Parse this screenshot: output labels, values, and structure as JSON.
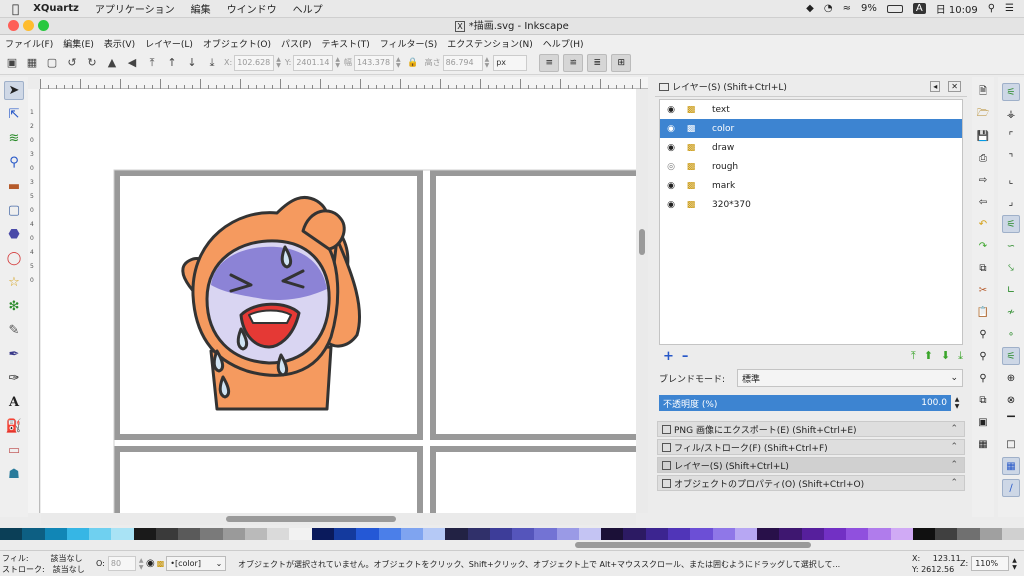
{
  "mac_menubar": {
    "app_name": "XQuartz",
    "items": [
      "アプリケーション",
      "編集",
      "ウインドウ",
      "ヘルプ"
    ],
    "battery": "9%",
    "input_mode": "A",
    "clock": "日 10:09"
  },
  "window": {
    "title": "*描画.svg - Inkscape"
  },
  "menu": [
    "ファイル(F)",
    "編集(E)",
    "表示(V)",
    "レイヤー(L)",
    "オブジェクト(O)",
    "パス(P)",
    "テキスト(T)",
    "フィルター(S)",
    "エクステンション(N)",
    "ヘルプ(H)"
  ],
  "toolbar": {
    "x_label": "X:",
    "x_value": "102.628",
    "y_label": "Y:",
    "y_value": "2401.14",
    "w_label": "幅",
    "w_value": "143.378",
    "h_label": "高さ",
    "h_value": "86.794",
    "unit": "px"
  },
  "layers_panel": {
    "title": "レイヤー(S) (Shift+Ctrl+L)",
    "layers": [
      {
        "name": "text",
        "selected": false
      },
      {
        "name": "color",
        "selected": true
      },
      {
        "name": "draw",
        "selected": false
      },
      {
        "name": "rough",
        "selected": false
      },
      {
        "name": "mark",
        "selected": false
      },
      {
        "name": "320*370",
        "selected": false
      }
    ],
    "blend_label": "ブレンドモード:",
    "blend_value": "標準",
    "opacity_label": "不透明度 (%)",
    "opacity_value": "100.0"
  },
  "docked_dialogs": [
    "PNG 画像にエクスポート(E) (Shift+Ctrl+E)",
    "フィル/ストローク(F) (Shift+Ctrl+F)",
    "レイヤー(S) (Shift+Ctrl+L)",
    "オブジェクトのプロパティ(O) (Shift+Ctrl+O)"
  ],
  "statusbar": {
    "fill_label": "フィル:",
    "fill_value": "該当なし",
    "stroke_label": "ストローク:",
    "stroke_value": "該当なし",
    "opacity_label": "O:",
    "opacity_value": "80",
    "layer_value": "•[color]",
    "message": "オブジェクトが選択されていません。オブジェクトをクリック、Shift+クリック、オブジェクト上で Alt+マウススクロール、または囲むようにドラッグして選択して...",
    "x_label": "X:",
    "x_value": "123.11",
    "y_label": "Y:",
    "y_value": "2612.56",
    "zoom_label": "Z:",
    "zoom_value": "110%"
  },
  "ruler_left_labels": [
    "1",
    "2",
    "0",
    "3",
    "0",
    "3",
    "5",
    "0",
    "4",
    "0",
    "4",
    "5",
    "0"
  ],
  "palette_colors": [
    "#0b3f57",
    "#0d5f83",
    "#1186b6",
    "#36b6e5",
    "#6fd0f0",
    "#a9e3f5",
    "#1a1a1a",
    "#3a3a3a",
    "#5a5a5a",
    "#7a7a7a",
    "#9a9a9a",
    "#bababa",
    "#dadada",
    "#f2f2f2",
    "#0a1a5c",
    "#143a9e",
    "#2458d6",
    "#4b7fe9",
    "#7fa4f0",
    "#b5c9f6",
    "#222244",
    "#30306a",
    "#3d3d99",
    "#5555bb",
    "#7373d4",
    "#9a9ae6",
    "#c4c4f3",
    "#1b1037",
    "#2c1a63",
    "#3c2590",
    "#5035b8",
    "#6c4fd6",
    "#8f77e8",
    "#b7a7f3",
    "#281049",
    "#3e1770",
    "#561f9c",
    "#7230c4",
    "#9050de",
    "#b07cec",
    "#d0aaf5",
    "#101010",
    "#404040",
    "#707070",
    "#a0a0a0",
    "#d0d0d0"
  ]
}
